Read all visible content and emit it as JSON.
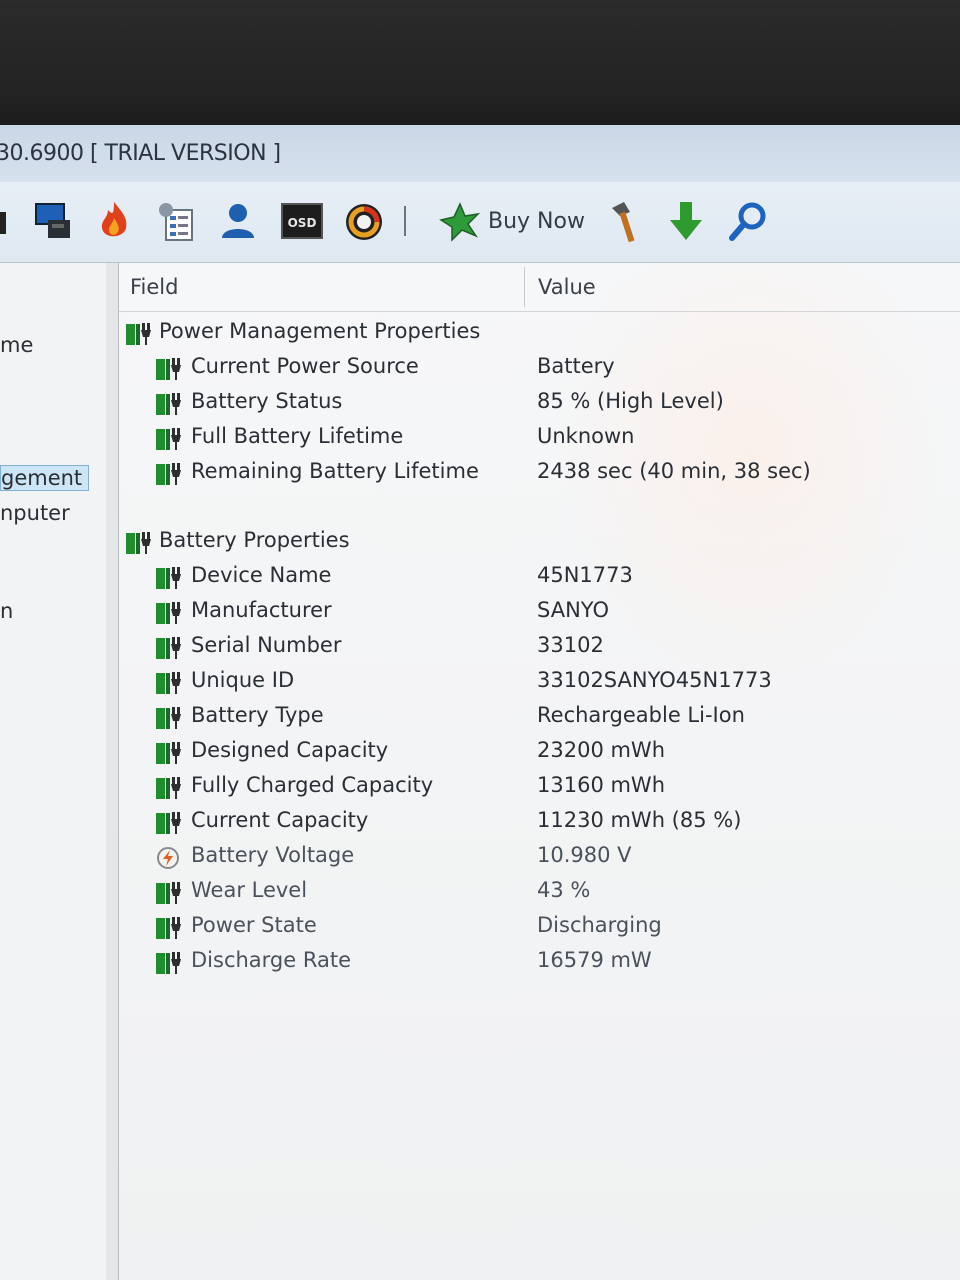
{
  "window": {
    "title": "30.6900  [ TRIAL VERSION ]"
  },
  "toolbar": {
    "icons": [
      "computer-icon",
      "flame-icon",
      "report-icon",
      "user-icon",
      "osd-icon",
      "gauge-icon",
      "buy-now-icon",
      "tools-icon",
      "download-arrow-icon",
      "search-icon"
    ],
    "buy_now_label": "Buy Now"
  },
  "sidebar": {
    "items": [
      {
        "label": "me"
      },
      {
        "label": "gement",
        "selected": true
      },
      {
        "label": "nputer"
      },
      {
        "label": "n"
      }
    ]
  },
  "table": {
    "columns": {
      "field": "Field",
      "value": "Value"
    },
    "groups": [
      {
        "title": "Power Management Properties",
        "rows": [
          {
            "field": "Current Power Source",
            "value": "Battery"
          },
          {
            "field": "Battery Status",
            "value": "85 % (High Level)"
          },
          {
            "field": "Full Battery Lifetime",
            "value": "Unknown"
          },
          {
            "field": "Remaining Battery Lifetime",
            "value": "2438 sec (40 min, 38 sec)"
          }
        ]
      },
      {
        "title": "Battery Properties",
        "rows": [
          {
            "field": "Device Name",
            "value": "45N1773"
          },
          {
            "field": "Manufacturer",
            "value": "SANYO"
          },
          {
            "field": "Serial Number",
            "value": "33102"
          },
          {
            "field": "Unique ID",
            "value": "33102SANYO45N1773"
          },
          {
            "field": "Battery Type",
            "value": "Rechargeable Li-Ion"
          },
          {
            "field": "Designed Capacity",
            "value": "23200 mWh"
          },
          {
            "field": "Fully Charged Capacity",
            "value": "13160 mWh"
          },
          {
            "field": "Current Capacity",
            "value": "11230 mWh  (85 %)"
          },
          {
            "field": "Battery Voltage",
            "value": "10.980 V",
            "icon": "voltage-icon"
          },
          {
            "field": "Wear Level",
            "value": "43 %"
          },
          {
            "field": "Power State",
            "value": "Discharging"
          },
          {
            "field": "Discharge Rate",
            "value": "16579 mW"
          }
        ]
      }
    ]
  },
  "colors": {
    "battery_green": "#1f8f2e",
    "selection": "#cde6f5"
  }
}
